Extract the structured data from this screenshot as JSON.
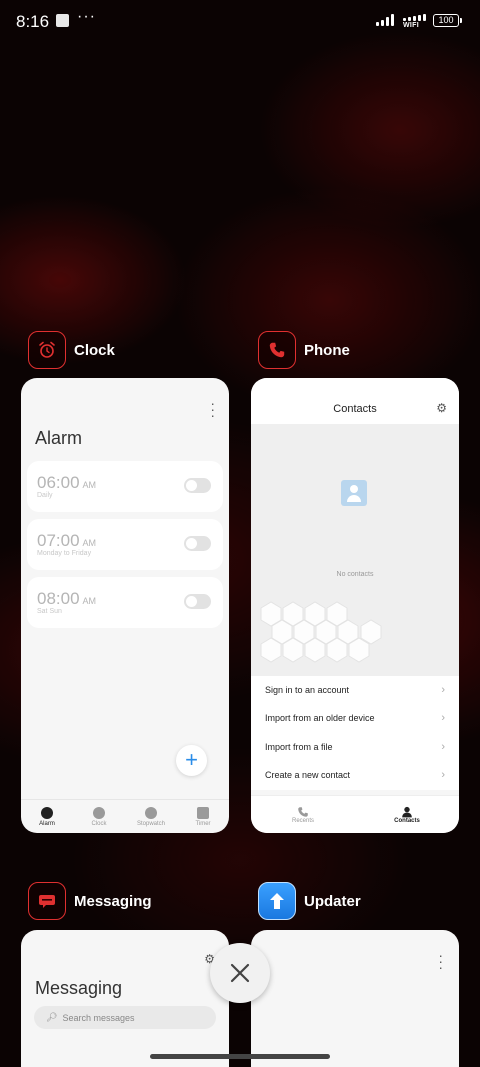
{
  "status_bar": {
    "time": "8:16",
    "more": "···",
    "wifi_label": "WIFI",
    "battery": "100"
  },
  "apps": {
    "clock": {
      "name": "Clock",
      "icon": "alarm-clock-icon",
      "screen": {
        "title": "Alarm",
        "alarms": [
          {
            "time": "06:00",
            "ampm": "AM",
            "repeat": "Daily",
            "enabled": false
          },
          {
            "time": "07:00",
            "ampm": "AM",
            "repeat": "Monday to Friday",
            "enabled": false
          },
          {
            "time": "08:00",
            "ampm": "AM",
            "repeat": "Sat Sun",
            "enabled": false
          }
        ],
        "tabs": [
          {
            "label": "Alarm",
            "active": true
          },
          {
            "label": "Clock",
            "active": false
          },
          {
            "label": "Stopwatch",
            "active": false
          },
          {
            "label": "Timer",
            "active": false
          }
        ]
      }
    },
    "phone": {
      "name": "Phone",
      "icon": "phone-handset-icon",
      "screen": {
        "title": "Contacts",
        "empty_text": "No contacts",
        "actions": [
          {
            "label": "Sign in to an account"
          },
          {
            "label": "Import from an older device"
          },
          {
            "label": "Import from a file"
          },
          {
            "label": "Create a new contact"
          }
        ],
        "tabs": [
          {
            "label": "Recents",
            "active": false
          },
          {
            "label": "Contacts",
            "active": true
          }
        ]
      }
    },
    "messaging": {
      "name": "Messaging",
      "icon": "message-bubble-icon",
      "screen": {
        "title": "Messaging",
        "search_placeholder": "Search messages"
      }
    },
    "updater": {
      "name": "Updater",
      "icon": "up-arrow-icon"
    }
  },
  "colors": {
    "accent_red": "#e03030",
    "fab_blue": "#2a8ce8",
    "updater_blue": "#1a78e0"
  }
}
